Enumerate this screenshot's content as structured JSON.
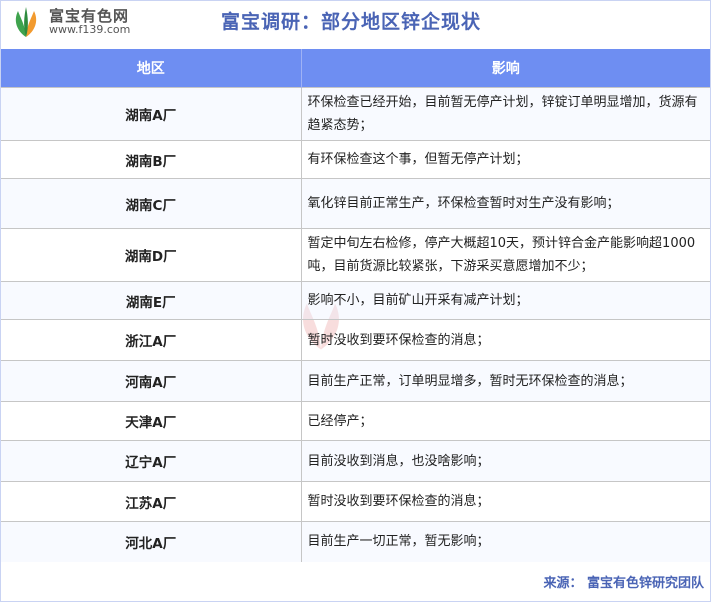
{
  "brand": {
    "name": "富宝有色网",
    "url": "www.f139.com"
  },
  "title": "富宝调研：部分地区锌企现状",
  "headers": {
    "region": "地区",
    "impact": "影响"
  },
  "rows": [
    {
      "region": "湖南A厂",
      "impact": "环保检查已经开始，目前暂无停产计划，锌锭订单明显增加，货源有趋紧态势；"
    },
    {
      "region": "湖南B厂",
      "impact": "有环保检查这个事，但暂无停产计划；"
    },
    {
      "region": "湖南C厂",
      "impact": "氧化锌目前正常生产，环保检查暂时对生产没有影响；"
    },
    {
      "region": "湖南D厂",
      "impact": "暂定中旬左右检修，停产大概超10天，预计锌合金产能影响超1000吨，目前货源比较紧张，下游采买意愿增加不少；"
    },
    {
      "region": "湖南E厂",
      "impact": "影响不小，目前矿山开采有减产计划；"
    },
    {
      "region": "浙江A厂",
      "impact": "暂时没收到要环保检查的消息；"
    },
    {
      "region": "河南A厂",
      "impact": "目前生产正常，订单明显增多，暂时无环保检查的消息；"
    },
    {
      "region": "天津A厂",
      "impact": "已经停产；"
    },
    {
      "region": "辽宁A厂",
      "impact": "目前没收到消息，也没啥影响；"
    },
    {
      "region": "江苏A厂",
      "impact": "暂时没收到要环保检查的消息；"
    },
    {
      "region": "河北A厂",
      "impact": "目前生产一切正常，暂无影响；"
    }
  ],
  "source": "来源：  富宝有色锌研究团队",
  "colors": {
    "header_bg": "#6e8ef2",
    "title": "#4a64b5",
    "logo_green": "#3fa34d",
    "logo_orange": "#f29a2e"
  },
  "icons": {
    "logo": "leaf-logo-icon",
    "watermark": "leaf-watermark-icon"
  }
}
